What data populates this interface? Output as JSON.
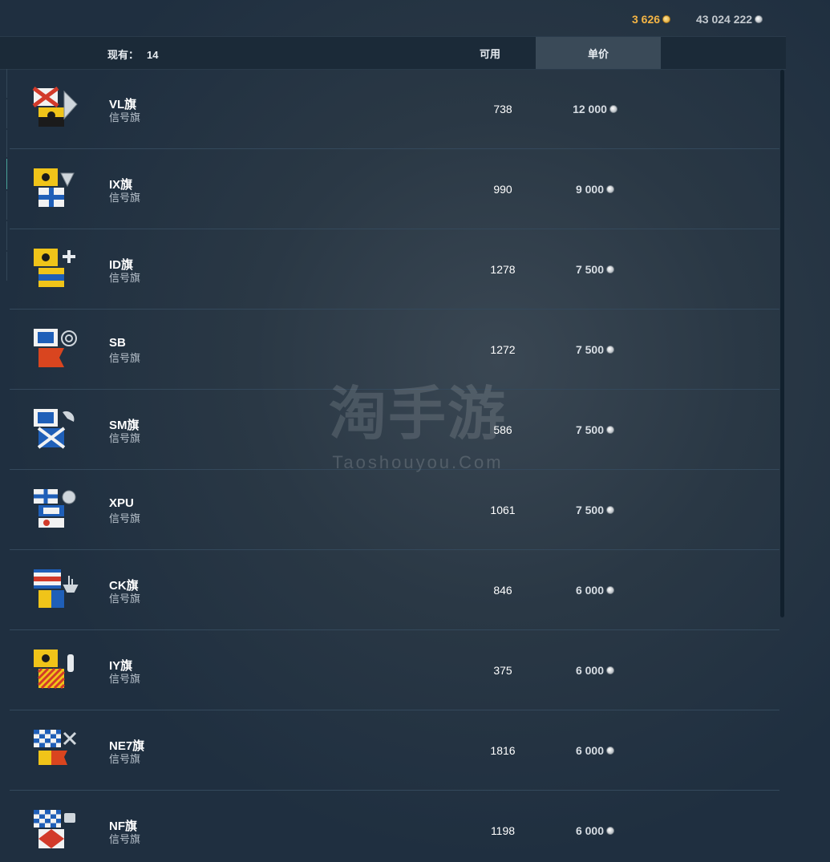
{
  "currency": {
    "gold": {
      "value": "3 626",
      "icon": "gold-coin-icon",
      "color": "#f5b544"
    },
    "silver": {
      "value": "43 024 222",
      "icon": "silver-coin-icon",
      "color": "#c3c9cf"
    }
  },
  "header": {
    "owned_label": "现有：",
    "owned_count": "14",
    "available_label": "可用",
    "price_label": "单价"
  },
  "rows": [
    {
      "name": "VL旗",
      "type": "信号旗",
      "available": "738",
      "price": "12 000",
      "icon": "vl-signal-flag-icon"
    },
    {
      "name": "IX旗",
      "type": "信号旗",
      "available": "990",
      "price": "9 000",
      "icon": "ix-signal-flag-icon"
    },
    {
      "name": "ID旗",
      "type": "信号旗",
      "available": "1278",
      "price": "7 500",
      "icon": "id-signal-flag-icon"
    },
    {
      "name": "SB",
      "type": "信号旗",
      "available": "1272",
      "price": "7 500",
      "icon": "sb-signal-flag-icon"
    },
    {
      "name": "SM旗",
      "type": "信号旗",
      "available": "586",
      "price": "7 500",
      "icon": "sm-signal-flag-icon"
    },
    {
      "name": "XPU",
      "type": "信号旗",
      "available": "1061",
      "price": "7 500",
      "icon": "xpu-signal-flag-icon"
    },
    {
      "name": "CK旗",
      "type": "信号旗",
      "available": "846",
      "price": "6 000",
      "icon": "ck-signal-flag-icon"
    },
    {
      "name": "IY旗",
      "type": "信号旗",
      "available": "375",
      "price": "6 000",
      "icon": "iy-signal-flag-icon"
    },
    {
      "name": "NE7旗",
      "type": "信号旗",
      "available": "1816",
      "price": "6 000",
      "icon": "ne7-signal-flag-icon"
    },
    {
      "name": "NF旗",
      "type": "信号旗",
      "available": "1198",
      "price": "6 000",
      "icon": "nf-signal-flag-icon"
    }
  ],
  "watermark": {
    "main": "淘手游",
    "sub": "Taoshouyou.Com"
  },
  "colors": {
    "background": "#1f2f40",
    "header_bg": "#1b2a38",
    "active_column_bg": "#3a4a58",
    "row_divider": "#34495c"
  }
}
